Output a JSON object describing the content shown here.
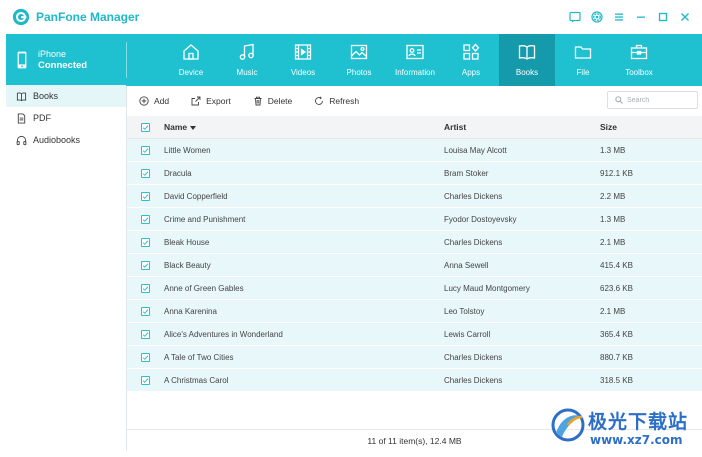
{
  "app": {
    "title": "PanFone Manager"
  },
  "device": {
    "name": "iPhone",
    "status": "Connected"
  },
  "nav": [
    {
      "label": "Device",
      "icon": "home-icon"
    },
    {
      "label": "Music",
      "icon": "music-note-icon"
    },
    {
      "label": "Videos",
      "icon": "film-icon"
    },
    {
      "label": "Photos",
      "icon": "image-icon"
    },
    {
      "label": "Information",
      "icon": "contact-card-icon"
    },
    {
      "label": "Apps",
      "icon": "apps-grid-icon"
    },
    {
      "label": "Books",
      "icon": "open-book-icon",
      "active": true
    },
    {
      "label": "File",
      "icon": "folder-icon"
    },
    {
      "label": "Toolbox",
      "icon": "toolbox-icon"
    }
  ],
  "sidebar": {
    "items": [
      {
        "label": "Books",
        "icon": "book-icon",
        "active": true
      },
      {
        "label": "PDF",
        "icon": "document-icon"
      },
      {
        "label": "Audiobooks",
        "icon": "headphones-icon"
      }
    ]
  },
  "toolbar": {
    "add_label": "Add",
    "export_label": "Export",
    "delete_label": "Delete",
    "refresh_label": "Refresh",
    "search_placeholder": "Search"
  },
  "table": {
    "columns": {
      "name": "Name",
      "artist": "Artist",
      "size": "Size"
    },
    "rows": [
      {
        "name": "Little Women",
        "artist": "Louisa May Alcott",
        "size": "1.3 MB"
      },
      {
        "name": "Dracula",
        "artist": "Bram Stoker",
        "size": "912.1 KB"
      },
      {
        "name": "David Copperfield",
        "artist": "Charles Dickens",
        "size": "2.2 MB"
      },
      {
        "name": "Crime and Punishment",
        "artist": "Fyodor Dostoyevsky",
        "size": "1.3 MB"
      },
      {
        "name": "Bleak House",
        "artist": "Charles Dickens",
        "size": "2.1 MB"
      },
      {
        "name": "Black Beauty",
        "artist": "Anna Sewell",
        "size": "415.4 KB"
      },
      {
        "name": "Anne of Green Gables",
        "artist": "Lucy Maud Montgomery",
        "size": "623.6 KB"
      },
      {
        "name": "Anna Karenina",
        "artist": "Leo Tolstoy",
        "size": "2.1 MB"
      },
      {
        "name": "Alice's Adventures in Wonderland",
        "artist": "Lewis Carroll",
        "size": "365.4 KB"
      },
      {
        "name": "A Tale of Two Cities",
        "artist": "Charles Dickens",
        "size": "880.7 KB"
      },
      {
        "name": "A Christmas Carol",
        "artist": "Charles Dickens",
        "size": "318.5 KB"
      }
    ]
  },
  "status": {
    "text": "11 of 11 item(s), 12.4 MB"
  },
  "watermark": {
    "brand": "极光下载站",
    "url": "www.xz7.com"
  },
  "colors": {
    "accent": "#1fc0d0",
    "accent_dark": "#149aab",
    "row_selected": "#e8f7fa"
  }
}
